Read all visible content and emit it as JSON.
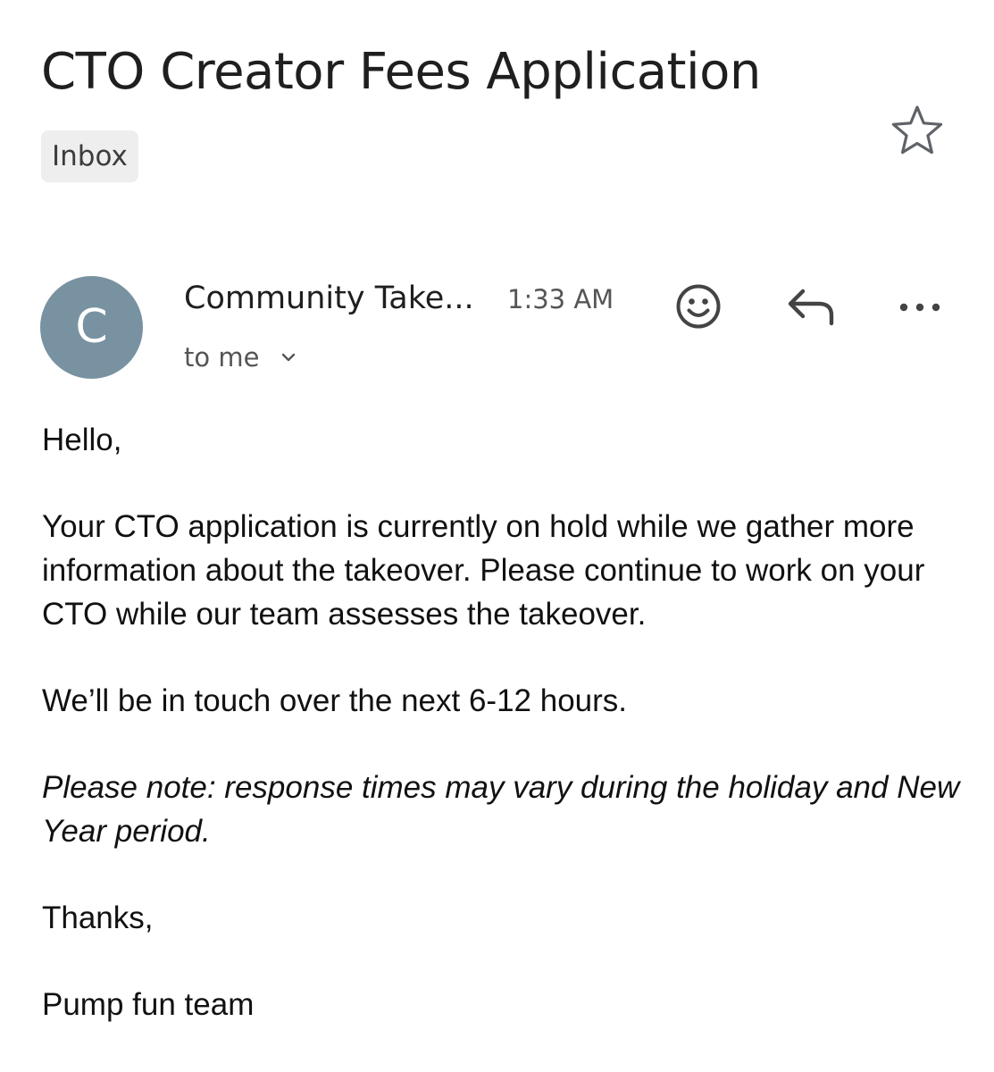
{
  "email": {
    "subject": "CTO Creator Fees Application",
    "label": "Inbox",
    "star_icon": "star-outline-icon",
    "sender": {
      "avatar_letter": "C",
      "avatar_color": "#7892a1",
      "name": "Community Take...",
      "time": "1:33 AM",
      "recipient": "to me"
    },
    "actions": {
      "emoji_icon": "smiley-icon",
      "reply_icon": "reply-arrow-icon",
      "more_icon": "more-horizontal-icon"
    },
    "body": {
      "greeting": "Hello,",
      "paragraph_1": "Your CTO application is currently on hold while we gather more information about the takeover. Please continue to work on your CTO while our team assesses the takeover.",
      "paragraph_2": "We’ll be in touch over the next 6-12 hours.",
      "note": "Please note: response times may vary during the holiday and New Year period.",
      "closing": "Thanks,",
      "signature": "Pump fun team"
    }
  }
}
